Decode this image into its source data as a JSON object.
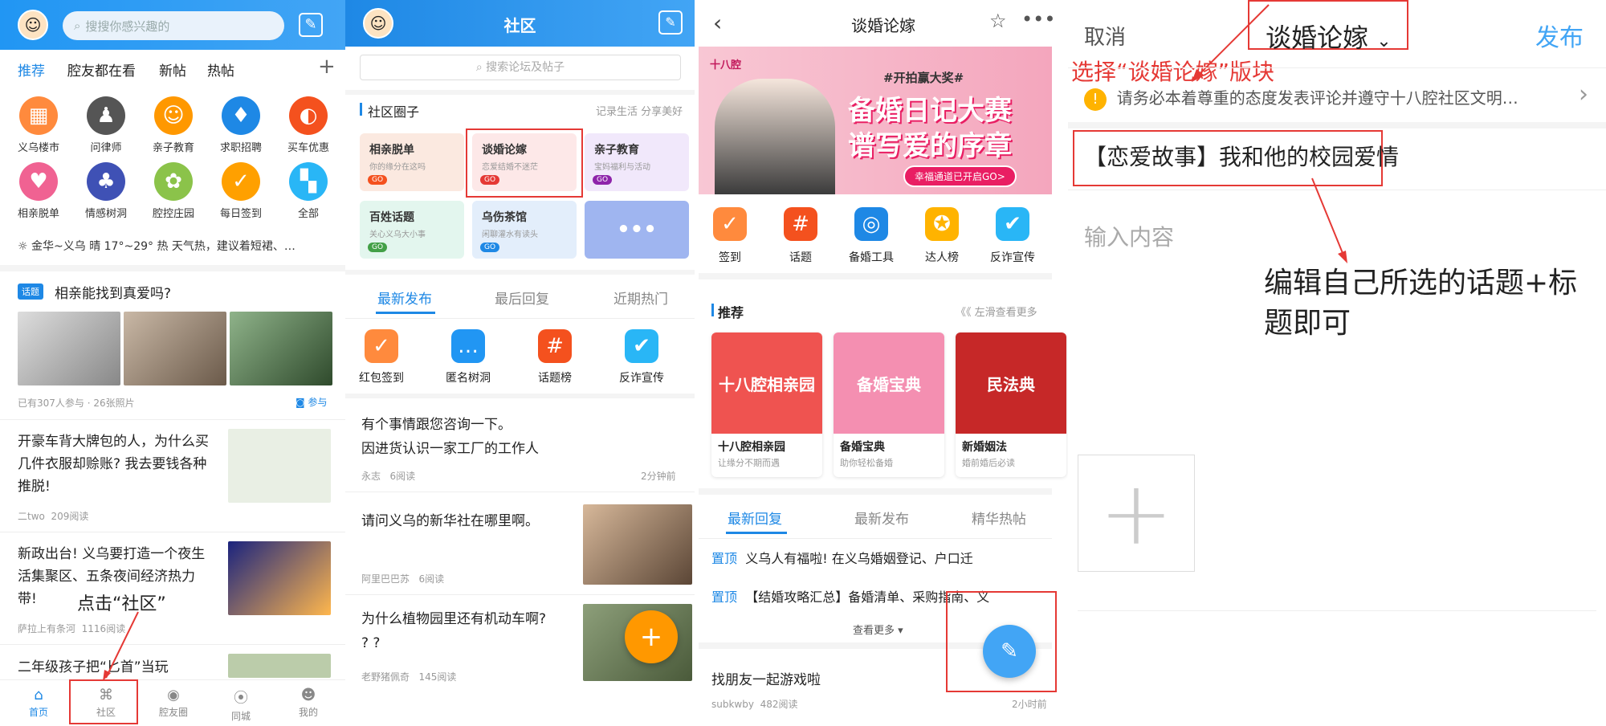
{
  "p1": {
    "search_placeholder": "搜搜你感兴趣的",
    "tabs": [
      "推荐",
      "腔友都在看",
      "新帖",
      "热帖"
    ],
    "plus": "+",
    "grid": [
      {
        "label": "义乌楼市",
        "icon": "building-icon",
        "color": "#ff8a3d"
      },
      {
        "label": "问律师",
        "icon": "lawyer-icon",
        "color": "#555"
      },
      {
        "label": "亲子教育",
        "icon": "child-icon",
        "color": "#ff9800"
      },
      {
        "label": "求职招聘",
        "icon": "job-icon",
        "color": "#1e88e5"
      },
      {
        "label": "买车优惠",
        "icon": "car-icon",
        "color": "#f4511e"
      },
      {
        "label": "相亲脱单",
        "icon": "heart-icon",
        "color": "#f06292"
      },
      {
        "label": "情感树洞",
        "icon": "tree-icon",
        "color": "#3f51b5"
      },
      {
        "label": "腔控庄园",
        "icon": "farm-icon",
        "color": "#8bc34a"
      },
      {
        "label": "每日签到",
        "icon": "checkin-icon",
        "color": "#ffa000"
      },
      {
        "label": "全部",
        "icon": "all-icon",
        "color": "#29b6f6"
      }
    ],
    "weather": "金华~义乌 晴 17°~29° 热 天气热，建议着短裙、…",
    "topic_tag": "话题",
    "topic_title": "相亲能找到真爱吗?",
    "topic_meta": "已有307人参与 · 26张照片",
    "topic_join": "参与",
    "posts": [
      {
        "title": "开豪车背大牌包的人，为什么买几件衣服却赊账? 我去要钱各种推脱!",
        "author": "二two",
        "reads": "209阅读"
      },
      {
        "title": "新政出台! 义乌要打造一个夜生活集聚区、五条夜间经济热力带!",
        "author": "萨拉上有条河",
        "reads": "1116阅读"
      },
      {
        "title": "二年级孩子把“匕首”当玩"
      }
    ],
    "bottom": [
      "首页",
      "社区",
      "腔友圈",
      "同城",
      "我的"
    ],
    "annotation": "点击“社区”"
  },
  "p2": {
    "title": "社区",
    "search_placeholder": "搜索论坛及帖子",
    "section_title": "社区圈子",
    "section_right": "记录生活 分享美好",
    "cards": [
      {
        "title": "相亲脱单",
        "sub": "你的缘分在这吗",
        "bg": "#fbe9e0",
        "go": "#f4511e"
      },
      {
        "title": "谈婚论嫁",
        "sub": "恋爱结婚不迷茫",
        "bg": "#fde8e8",
        "go": "#e53935"
      },
      {
        "title": "亲子教育",
        "sub": "宝妈福利与活动",
        "bg": "#f1e8fb",
        "go": "#8e24aa"
      },
      {
        "title": "百姓话题",
        "sub": "关心义乌大小事",
        "bg": "#e3f6ee",
        "go": "#43a047"
      },
      {
        "title": "乌伤茶馆",
        "sub": "闲聊灌水有读头",
        "bg": "#e3eefb",
        "go": "#1e88e5"
      }
    ],
    "more": "•••",
    "tabs": [
      "最新发布",
      "最后回复",
      "近期热门"
    ],
    "tools": [
      {
        "label": "红包签到",
        "icon": "redpacket-checkin-icon",
        "color": "#ff8a3d"
      },
      {
        "label": "匿名树洞",
        "icon": "chat-bubble-icon",
        "color": "#2196f3"
      },
      {
        "label": "话题榜",
        "icon": "hashtag-icon",
        "color": "#f4511e"
      },
      {
        "label": "反诈宣传",
        "icon": "shield-icon",
        "color": "#29b6f6"
      }
    ],
    "posts": [
      {
        "title": "有个事情跟您咨询一下。\n因进货认识一家工厂的工作人",
        "author": "永志",
        "reads": "6阅读",
        "time": "2分钟前"
      },
      {
        "title": "请问义乌的新华社在哪里啊。",
        "author": "阿里巴巴苏",
        "reads": "6阅读"
      },
      {
        "title": "为什么植物园里还有机动车啊? ? ?",
        "author": "老野猪佩奇",
        "reads": "145阅读"
      }
    ]
  },
  "p3": {
    "title": "谈婚论嫁",
    "banner_tag": "#开拍赢大奖#",
    "banner_line1": "备婚日记大赛",
    "banner_line2": "谱写爱的序章",
    "banner_btn": "幸福通道已开启GO>",
    "banner_logo": "十八腔",
    "tools": [
      {
        "label": "签到",
        "icon": "checkin-icon",
        "color": "#ff8a3d"
      },
      {
        "label": "话题",
        "icon": "hashtag-icon",
        "color": "#f4511e"
      },
      {
        "label": "备婚工具",
        "icon": "target-icon",
        "color": "#1e88e5"
      },
      {
        "label": "达人榜",
        "icon": "medal-icon",
        "color": "#ffb300"
      },
      {
        "label": "反诈宣传",
        "icon": "shield-icon",
        "color": "#29b6f6"
      }
    ],
    "rec_title": "推荐",
    "rec_more": "《《 左滑查看更多",
    "rec": [
      {
        "title": "十八腔相亲园",
        "sub": "让缘分不期而遇",
        "img_text": "十八腔相亲园",
        "bg": "#ef5350"
      },
      {
        "title": "备婚宝典",
        "sub": "助你轻松备婚",
        "img_text": "备婚宝典",
        "bg": "#f48fb1"
      },
      {
        "title": "新婚姻法",
        "sub": "婚前婚后必读",
        "img_text": "民法典",
        "bg": "#c62828"
      }
    ],
    "tabs": [
      "最新回复",
      "最新发布",
      "精华热帖"
    ],
    "pins": [
      {
        "tag": "置顶",
        "title": "义乌人有福啦! 在义乌婚姻登记、户口迁"
      },
      {
        "tag": "置顶",
        "title": "【结婚攻略汇总】备婚清单、采购指南、义"
      }
    ],
    "see_more": "查看更多",
    "post_title": "找朋友一起游戏啦",
    "post_author": "subkwby",
    "post_reads": "482阅读",
    "post_time": "2小时前"
  },
  "p4": {
    "cancel": "取消",
    "board": "谈婚论嫁",
    "publish": "发布",
    "annotation_select": "选择“谈婚论嫁”版块",
    "notice": "请务必本着尊重的态度发表评论并遵守十八腔社区文明…",
    "title_value": "【恋爱故事】我和他的校园爱情",
    "content_placeholder": "输入内容",
    "annotation_edit": "编辑自己所选的话题+标题即可",
    "add": "+"
  },
  "colors": {
    "brand_blue": "#1e88e5",
    "annotation_red": "#e53935",
    "fab_orange": "#ff9800"
  }
}
